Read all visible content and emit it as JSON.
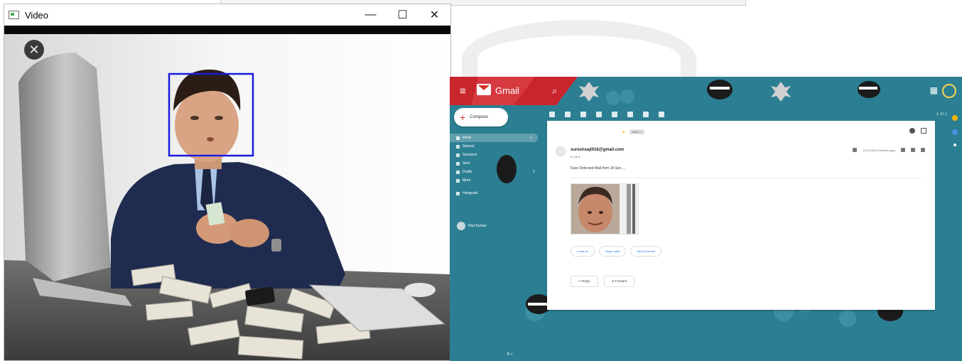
{
  "video_window": {
    "title": "Video",
    "controls": {
      "minimize": "—",
      "maximize": "☐",
      "close": "✕"
    },
    "overlay_close": "✕"
  },
  "gmail": {
    "logo_text": "Gmail",
    "compose_label": "Compose",
    "nav": [
      {
        "label": "Inbox",
        "count": "1"
      },
      {
        "label": "Starred",
        "count": ""
      },
      {
        "label": "Snoozed",
        "count": ""
      },
      {
        "label": "Sent",
        "count": ""
      },
      {
        "label": "Drafts",
        "count": "1"
      },
      {
        "label": "More",
        "count": ""
      }
    ],
    "label_group": "Hangouts",
    "hangout_user": "Hari Kumar",
    "email": {
      "subject_chip": "Inbox ×",
      "sender": "sureshsaji016@gmail.com",
      "to": "to me ▾",
      "body": "Face Detected Mail from 20 Sec....",
      "time": "12:16 PM (2 minutes ago)",
      "smart_replies": [
        "Looks ok",
        "Okay noted",
        "Sent to Daniel"
      ],
      "reply_label": "Reply",
      "forward_label": "Forward"
    },
    "toolbar_count": "1 of 1"
  },
  "colors": {
    "gmail_teal": "#2c7f93",
    "detect_box": "#1a1ae0",
    "gmail_red": "#d93025"
  }
}
